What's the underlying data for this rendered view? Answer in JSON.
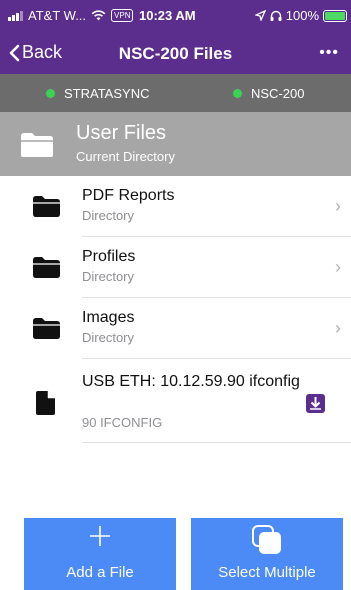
{
  "status_bar": {
    "carrier": "AT&T W...",
    "vpn": "VPN",
    "time": "10:23 AM",
    "battery": "100%"
  },
  "nav": {
    "back_label": "Back",
    "title": "NSC-200 Files",
    "more": "•••"
  },
  "connections": [
    {
      "label": "STRATASYNC",
      "status_color": "#39d353"
    },
    {
      "label": "NSC-200",
      "status_color": "#39d353"
    }
  ],
  "current_directory": {
    "name": "User Files",
    "subtitle": "Current Directory"
  },
  "items": [
    {
      "name": "PDF Reports",
      "type": "Directory",
      "icon": "folder-icon"
    },
    {
      "name": "Profiles",
      "type": "Directory",
      "icon": "folder-icon"
    },
    {
      "name": "Images",
      "type": "Directory",
      "icon": "folder-icon"
    }
  ],
  "file": {
    "name": "USB ETH: 10.12.59.90 ifconfig",
    "type": "90 IFCONFIG",
    "icon": "file-icon",
    "action_icon": "download-icon"
  },
  "actions": {
    "add_label": "Add a File",
    "add_icon": "plus-icon",
    "select_label": "Select Multiple",
    "select_icon": "select-multiple-icon"
  },
  "colors": {
    "header": "#5b2d8d",
    "connection_bar": "#6c6c6c",
    "current_dir_bar": "#a6a6a6",
    "button": "#4c8bf5",
    "download_icon": "#5b2d8d"
  }
}
